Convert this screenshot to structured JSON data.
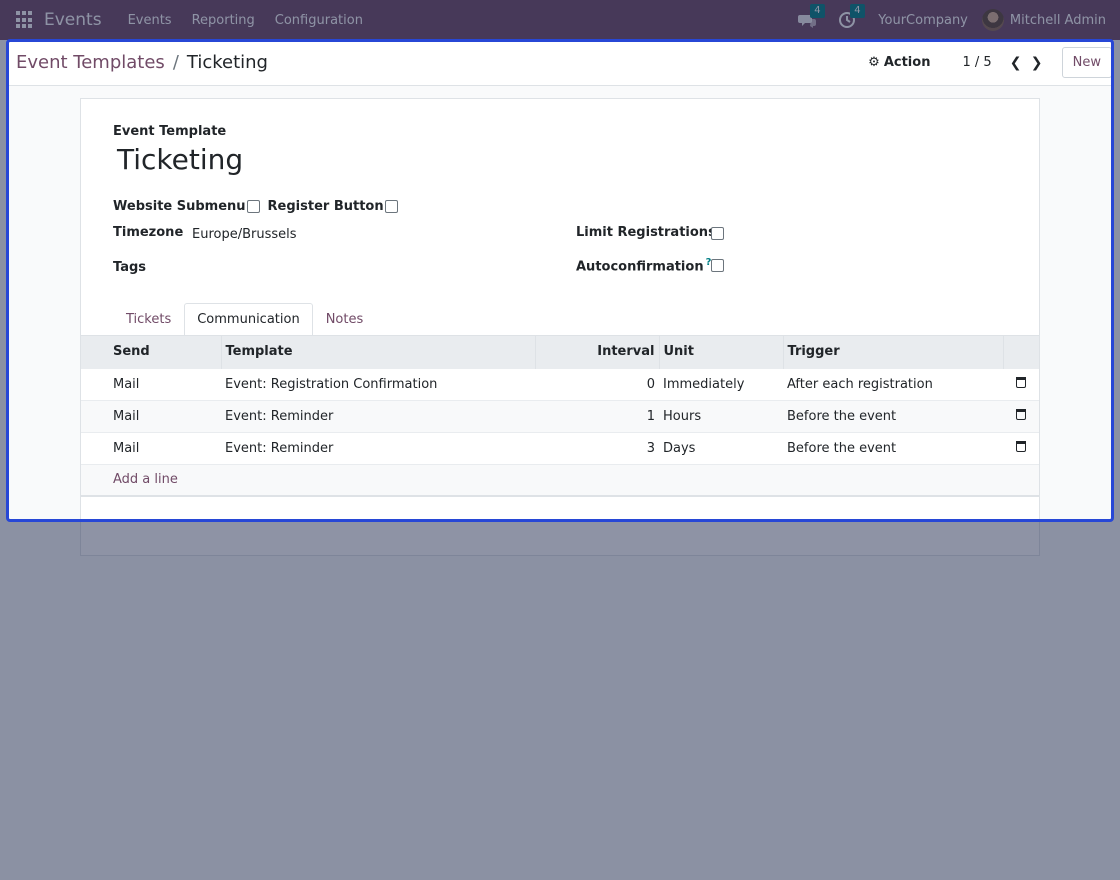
{
  "navbar": {
    "brand": "Events",
    "menu": [
      "Events",
      "Reporting",
      "Configuration"
    ],
    "messages_count": "4",
    "activities_count": "4",
    "company": "YourCompany",
    "user": "Mitchell Admin"
  },
  "control": {
    "breadcrumb_parent": "Event Templates",
    "breadcrumb_sep": "/",
    "breadcrumb_current": "Ticketing",
    "action_label": "Action",
    "pager": "1 / 5",
    "new_label": "New"
  },
  "form": {
    "title_label": "Event Template",
    "title": "Ticketing",
    "website_submenu_label": "Website Submenu",
    "register_button_label": "Register Button",
    "timezone_label": "Timezone",
    "timezone_value": "Europe/Brussels",
    "tags_label": "Tags",
    "limit_label": "Limit Registrations",
    "autoconfirm_label": "Autoconfirmation",
    "autoconfirm_help": "?"
  },
  "tabs": [
    "Tickets",
    "Communication",
    "Notes"
  ],
  "table": {
    "headers": [
      "Send",
      "Template",
      "Interval",
      "Unit",
      "Trigger"
    ],
    "rows": [
      {
        "send": "Mail",
        "template": "Event: Registration Confirmation",
        "interval": "0",
        "unit": "Immediately",
        "trigger": "After each registration"
      },
      {
        "send": "Mail",
        "template": "Event: Reminder",
        "interval": "1",
        "unit": "Hours",
        "trigger": "Before the event"
      },
      {
        "send": "Mail",
        "template": "Event: Reminder",
        "interval": "3",
        "unit": "Days",
        "trigger": "Before the event"
      }
    ],
    "add_line": "Add a line"
  },
  "colors": {
    "navbar": "#714b67",
    "link": "#714b67",
    "highlight_frame": "#2747d6",
    "badge": "#017e84"
  }
}
